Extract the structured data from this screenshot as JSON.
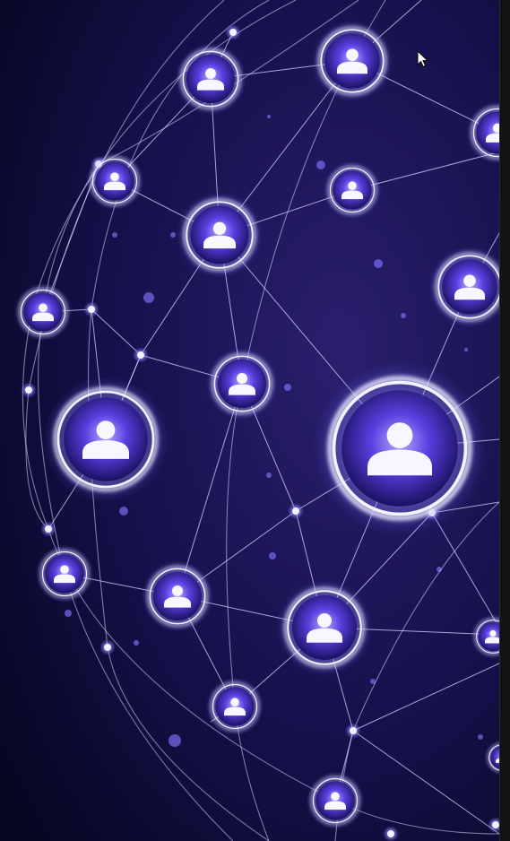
{
  "scene": {
    "subject": "people-network-globe-graphic",
    "node_icon": "person-icon",
    "colors": {
      "background_center": "#2a1f6e",
      "background_edge": "#070620",
      "node_glow": "#8f86ff",
      "node_core": "#4a33c9",
      "line": "#d9d6ff",
      "dot": "#7a6cf0"
    }
  },
  "cursor": {
    "icon": "mouse-pointer-icon"
  }
}
